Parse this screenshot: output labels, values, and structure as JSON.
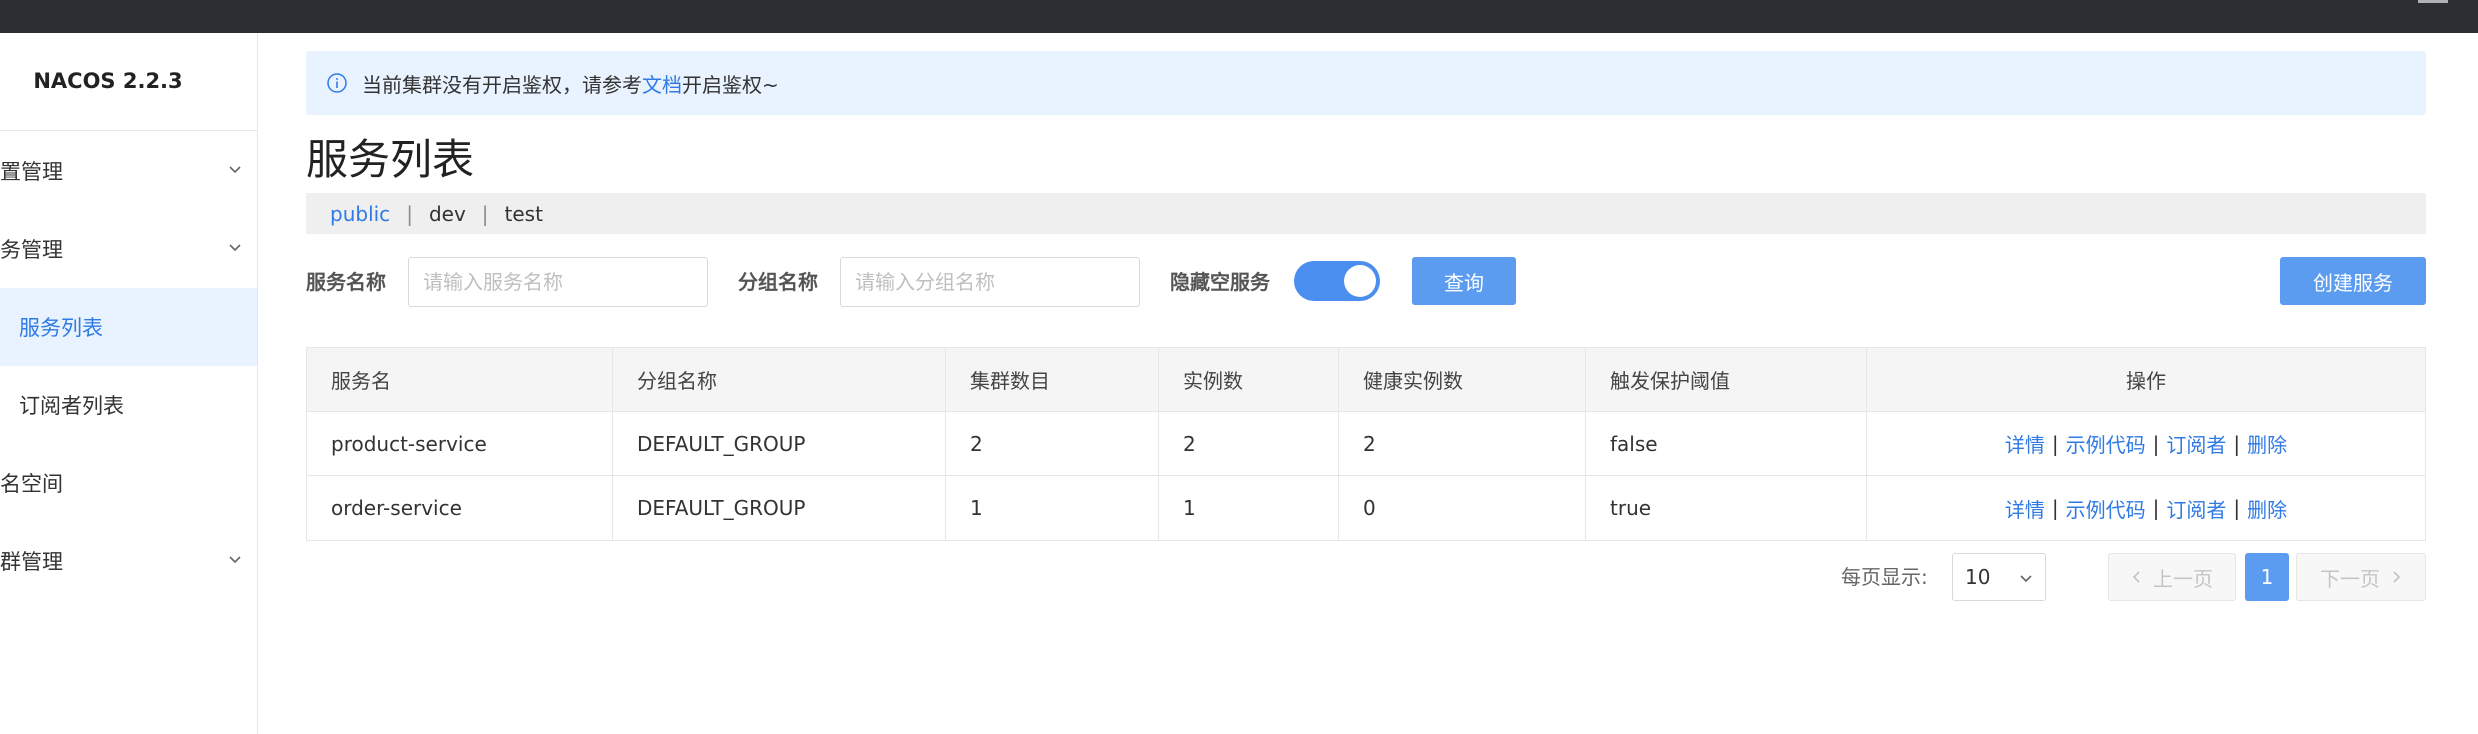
{
  "app": {
    "brand": "NACOS 2.2.3"
  },
  "sidebar": {
    "items": [
      {
        "label": "配置管理",
        "has_chevron": true
      },
      {
        "label": "服务管理",
        "has_chevron": true
      },
      {
        "label": "服务列表",
        "active": true
      },
      {
        "label": "订阅者列表"
      },
      {
        "label": "命名空间"
      },
      {
        "label": "集群管理",
        "has_chevron": true
      }
    ]
  },
  "alert": {
    "icon": "info-icon",
    "text_before": "当前集群没有开启鉴权，请参考",
    "link": "文档",
    "text_after": "开启鉴权~"
  },
  "page": {
    "title": "服务列表"
  },
  "namespaces": [
    {
      "label": "public",
      "active": true
    },
    {
      "label": "dev"
    },
    {
      "label": "test"
    }
  ],
  "filters": {
    "service_name_label": "服务名称",
    "service_name_placeholder": "请输入服务名称",
    "group_name_label": "分组名称",
    "group_name_placeholder": "请输入分组名称",
    "hide_empty_label": "隐藏空服务",
    "hide_empty_on": true,
    "query_button": "查询",
    "create_button": "创建服务"
  },
  "table": {
    "columns": [
      "服务名",
      "分组名称",
      "集群数目",
      "实例数",
      "健康实例数",
      "触发保护阈值",
      "操作"
    ],
    "rows": [
      {
        "service": "product-service",
        "group": "DEFAULT_GROUP",
        "clusters": "2",
        "instances": "2",
        "healthy": "2",
        "threshold": "false"
      },
      {
        "service": "order-service",
        "group": "DEFAULT_GROUP",
        "clusters": "1",
        "instances": "1",
        "healthy": "0",
        "threshold": "true"
      }
    ],
    "actions": [
      "详情",
      "示例代码",
      "订阅者",
      "删除"
    ]
  },
  "pagination": {
    "per_page_label": "每页显示:",
    "per_page_value": "10",
    "prev_label": "上一页",
    "next_label": "下一页",
    "current_page": "1"
  },
  "colors": {
    "accent": "#2f7ae5",
    "primary_button": "#5b9bf0",
    "alert_bg": "#e8f3ff",
    "topbar": "#2b2d33"
  }
}
